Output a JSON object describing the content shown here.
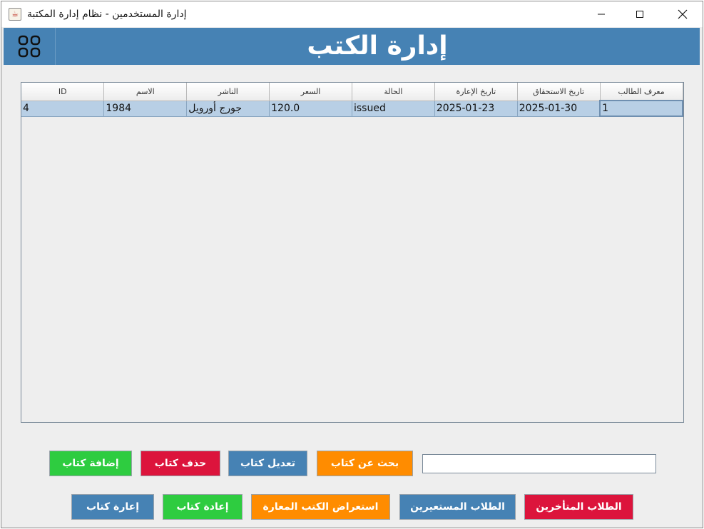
{
  "window": {
    "title": "إدارة المستخدمين - نظام إدارة المكتبة",
    "app_icon": "java-cup-icon",
    "controls": [
      "minimize-icon",
      "maximize-icon",
      "close-icon"
    ]
  },
  "header": {
    "title": "إدارة الكتب",
    "menu_icon": "grid-menu-icon",
    "color": "#4682b4"
  },
  "table": {
    "columns": [
      "ID",
      "الاسم",
      "الناشر",
      "السعر",
      "الحالة",
      "تاريخ الإعارة",
      "تاريخ الاستحقاق",
      "معرف الطالب"
    ],
    "rows": [
      [
        "4",
        "1984",
        "جورج أورويل",
        "120.0",
        "issued",
        "2025-01-23",
        "2025-01-30",
        "1"
      ]
    ]
  },
  "actions": {
    "add_book": "إضافة كتاب",
    "delete_book": "حذف كتاب",
    "edit_book": "تعديل كتاب",
    "search_book": "بحث عن كتاب",
    "lend_book": "إعارة كتاب",
    "return_book": "إعادة كتاب",
    "view_borrowed": "استعراض الكتب المعارة",
    "borrowing_students": "الطلاب المستعيرين",
    "late_students": "الطلاب المتأخرين"
  },
  "search": {
    "value": "",
    "placeholder": ""
  },
  "colors": {
    "green": "#2ecc40",
    "red": "#dc143c",
    "blue": "#4682b4",
    "orange": "#ff8c00"
  }
}
